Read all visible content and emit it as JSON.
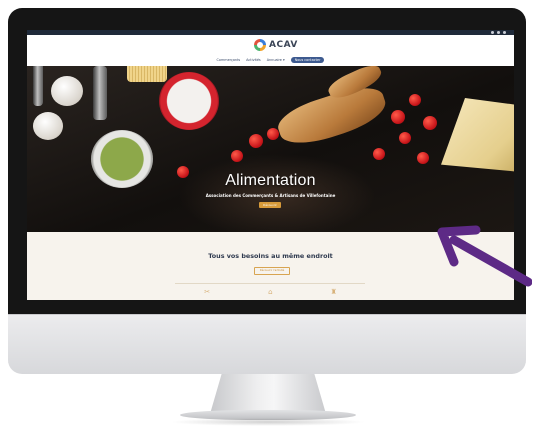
{
  "site": {
    "logo_text": "ACAV",
    "nav": [
      "Commerçants",
      "Activités",
      "Annuaire ▾",
      "Nous contacter"
    ],
    "hero": {
      "title": "Alimentation",
      "subtitle": "Association des Commerçants & Artisans de Villefontaine",
      "button_label": "Découvrir"
    },
    "section": {
      "title": "Tous vos besoins au même endroit",
      "button_label": "Découvrir l'activité"
    }
  },
  "colors": {
    "accent": "#d69a3a",
    "nav_cta": "#3d5a8f",
    "arrow": "#5d2a86"
  },
  "icons": [
    "logo-icon",
    "scissors-icon",
    "store-icon",
    "bag-icon"
  ]
}
